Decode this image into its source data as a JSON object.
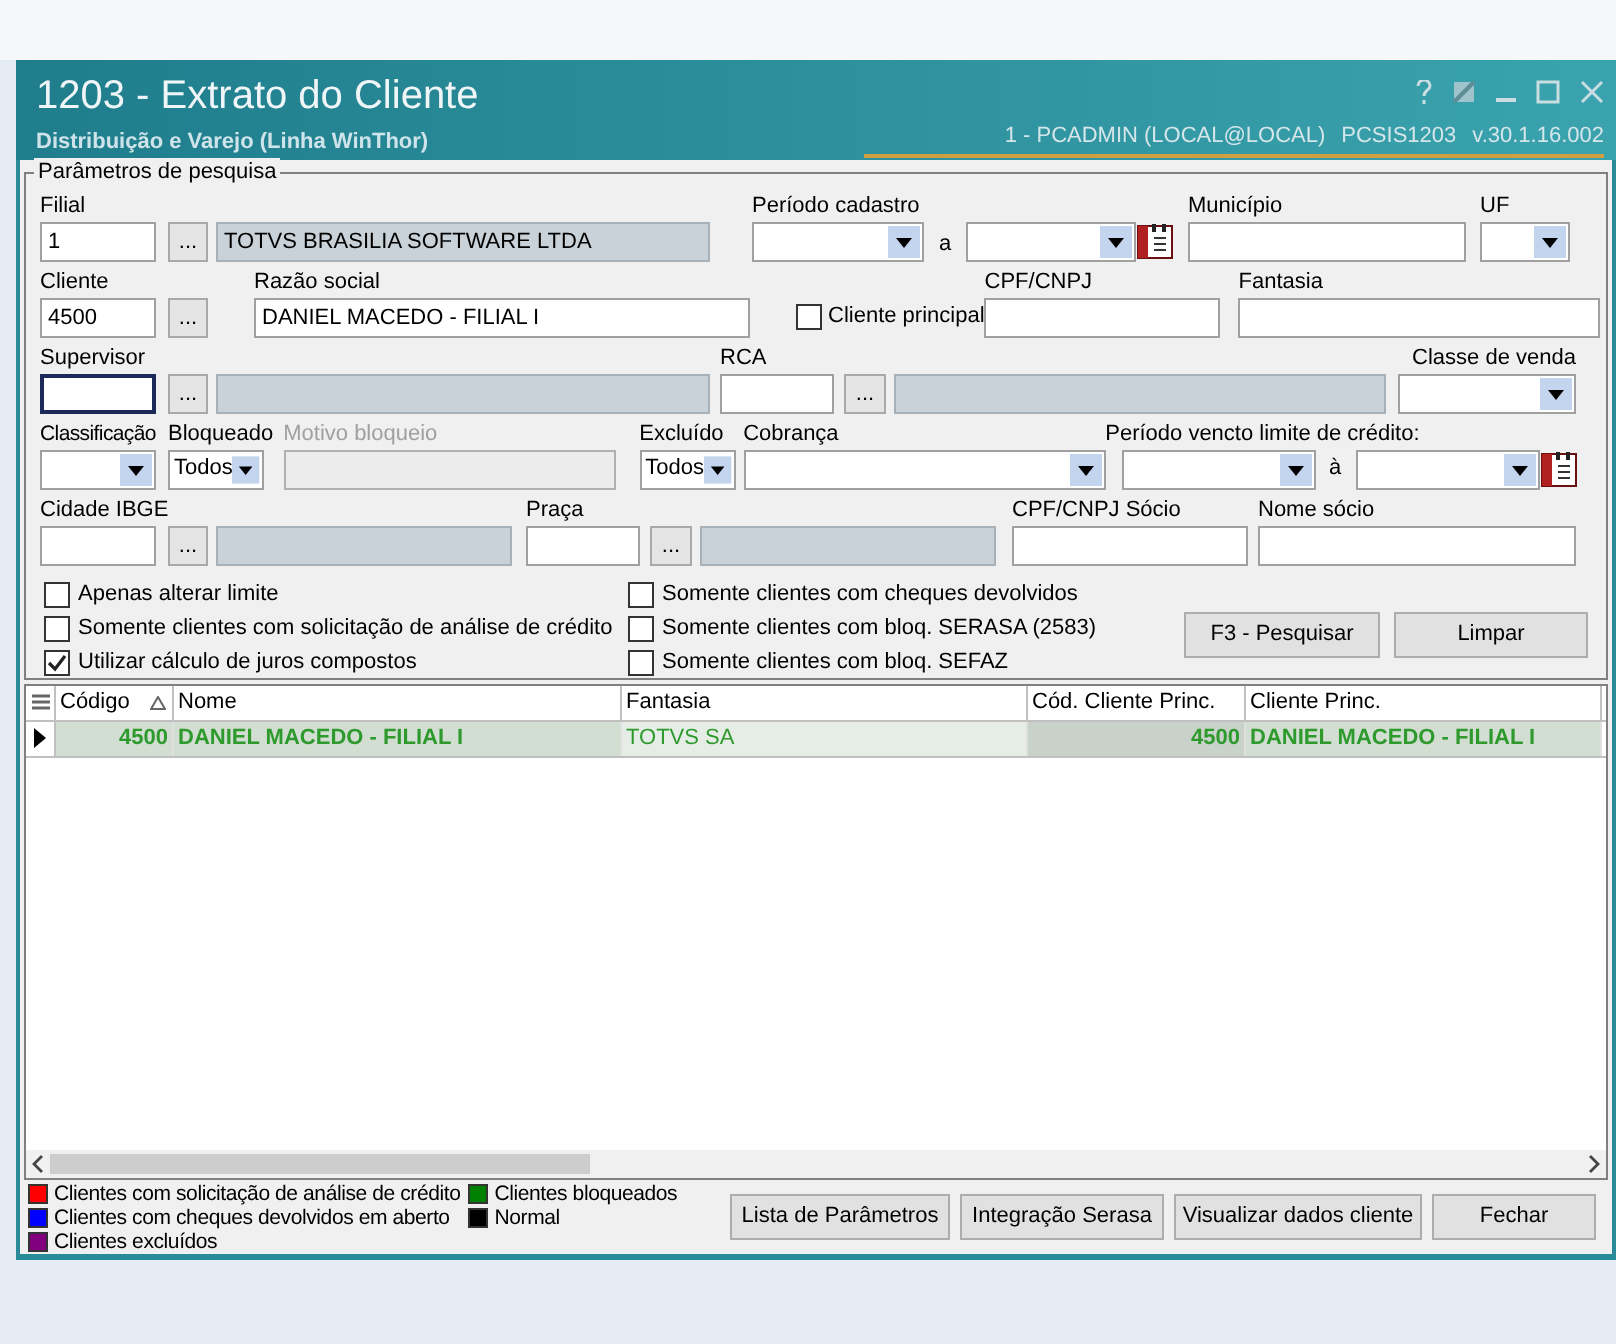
{
  "window": {
    "title": "1203 - Extrato do Cliente",
    "subtitle": "Distribuição e Varejo (Linha WinThor)",
    "session": "1 - PCADMIN (LOCAL@LOCAL)",
    "program": "PCSIS1203",
    "version": "v.30.1.16.002"
  },
  "parameters": {
    "legend": "Parâmetros de pesquisa",
    "filial": {
      "label": "Filial",
      "code": "1",
      "button": "...",
      "description": "TOTVS BRASILIA SOFTWARE LTDA"
    },
    "periodo_cadastro": {
      "label": "Período cadastro",
      "separator": "a"
    },
    "municipio": {
      "label": "Município"
    },
    "uf": {
      "label": "UF"
    },
    "cliente": {
      "label": "Cliente",
      "code": "4500",
      "button": "..."
    },
    "razao_social": {
      "label": "Razão social",
      "value": "DANIEL MACEDO - FILIAL I"
    },
    "cliente_principal": {
      "label": "Cliente principal",
      "checked": false
    },
    "cpf_cnpj": {
      "label": "CPF/CNPJ"
    },
    "fantasia": {
      "label": "Fantasia"
    },
    "supervisor": {
      "label": "Supervisor",
      "button": "...",
      "focused": true
    },
    "rca": {
      "label": "RCA",
      "button": "..."
    },
    "classe_venda": {
      "label": "Classe de venda"
    },
    "classificacao": {
      "label": "Classificação"
    },
    "bloqueado": {
      "label": "Bloqueado",
      "value": "Todos"
    },
    "motivo_bloqueio": {
      "label": "Motivo bloqueio",
      "disabled": true
    },
    "excluido": {
      "label": "Excluído",
      "value": "Todos"
    },
    "cobranca": {
      "label": "Cobrança"
    },
    "periodo_vencto": {
      "label": "Período vencto limite de crédito:",
      "separator": "à"
    },
    "cidade_ibge": {
      "label": "Cidade IBGE",
      "button": "..."
    },
    "praca": {
      "label": "Praça",
      "button": "..."
    },
    "cpf_cnpj_socio": {
      "label": "CPF/CNPJ Sócio"
    },
    "nome_socio": {
      "label": "Nome sócio"
    },
    "options_left": [
      {
        "label": "Apenas alterar limite",
        "checked": false
      },
      {
        "label": "Somente clientes com solicitação de análise de crédito",
        "checked": false
      },
      {
        "label": "Utilizar cálculo de juros compostos",
        "checked": true
      }
    ],
    "options_right": [
      {
        "label": "Somente clientes com cheques devolvidos",
        "checked": false
      },
      {
        "label": "Somente clientes com bloq. SERASA (2583)",
        "checked": false
      },
      {
        "label": "Somente clientes com bloq. SEFAZ",
        "checked": false
      }
    ],
    "buttons": [
      "F3 - Pesquisar",
      "Limpar"
    ]
  },
  "grid": {
    "columns": [
      {
        "label": "Código",
        "sorted": true
      },
      {
        "label": "Nome",
        "sorted": false
      },
      {
        "label": "Fantasia",
        "sorted": false
      },
      {
        "label": "Cód. Cliente Princ.",
        "sorted": false
      },
      {
        "label": "Cliente Princ.",
        "sorted": false
      }
    ],
    "rows": [
      {
        "selected": true,
        "color": "#2e9a2e",
        "cells": [
          "4500",
          "DANIEL MACEDO - FILIAL I",
          "TOTVS SA",
          "4500",
          "DANIEL MACEDO - FILIAL I"
        ]
      }
    ]
  },
  "legend": [
    {
      "label": "Clientes com solicitação de análise de crédito",
      "color": "#ff0000"
    },
    {
      "label": "Clientes com cheques devolvidos em aberto",
      "color": "#0000ff"
    },
    {
      "label": "Clientes excluídos",
      "color": "#800080"
    },
    {
      "label": "Clientes bloqueados",
      "color": "#008000"
    },
    {
      "label": "Normal",
      "color": "#000000"
    }
  ],
  "footer_buttons": [
    "Lista de Parâmetros",
    "Integração Serasa",
    "Visualizar dados cliente",
    "Fechar"
  ]
}
